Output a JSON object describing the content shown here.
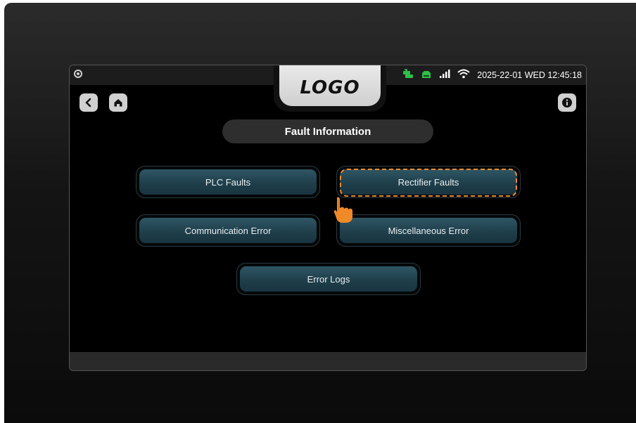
{
  "header": {
    "logo_text": "LOGO",
    "datetime": "2025-22-01 WED 12:45:18",
    "status_icons": [
      "battery-charging-icon",
      "network-icon",
      "signal-bars-icon",
      "wifi-icon"
    ]
  },
  "nav": {
    "back_icon": "chevron-left-icon",
    "home_icon": "home-icon",
    "info_icon": "info-icon"
  },
  "page": {
    "title": "Fault Information"
  },
  "menu": {
    "plc_faults": "PLC Faults",
    "rectifier_faults": "Rectifier Faults",
    "communication_error": "Communication Error",
    "miscellaneous_error": "Miscellaneous Error",
    "error_logs": "Error Logs"
  },
  "annotation": {
    "highlighted_item": "Rectifier Faults",
    "highlight_color": "#f08a28",
    "pointer_icon": "hand-pointer-icon"
  },
  "colors": {
    "button_bg": "#24495a",
    "status_green": "#2fbf4a",
    "accent_orange": "#f08a28"
  }
}
